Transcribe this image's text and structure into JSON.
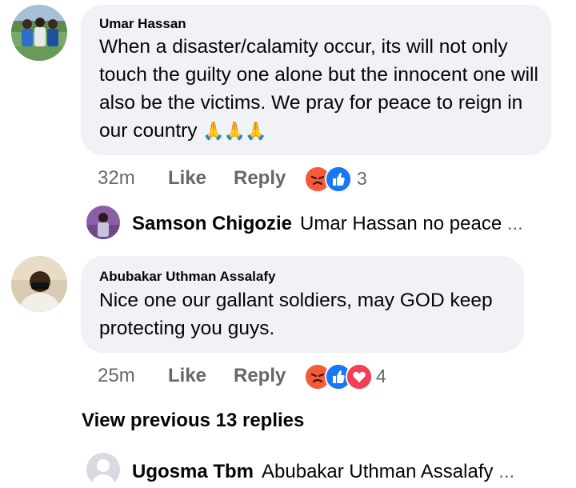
{
  "comments": [
    {
      "author": "Umar Hassan",
      "text": "When a disaster/calamity occur, its will not only touch the guilty one alone but the innocent one will also be the victims. We pray for peace to reign in our country",
      "emoji": "🙏🙏🙏",
      "time": "32m",
      "like_label": "Like",
      "reply_label": "Reply",
      "reactions": [
        "angry-reaction",
        "like-reaction"
      ],
      "reaction_count": "3",
      "reply_preview": {
        "author": "Samson Chigozie",
        "snippet": "Umar Hassan no peace",
        "ellipsis": "..."
      }
    },
    {
      "author": "Abubakar Uthman Assalafy",
      "text": "Nice one our gallant soldiers, may GOD keep protecting you guys.",
      "time": "25m",
      "like_label": "Like",
      "reply_label": "Reply",
      "reactions": [
        "angry-reaction",
        "like-reaction",
        "love-reaction"
      ],
      "reaction_count": "4",
      "view_previous": "View previous 13 replies",
      "reply_preview": {
        "author": "Ugosma Tbm",
        "snippet": "Abubakar Uthman Assalafy",
        "ellipsis": "..."
      }
    }
  ],
  "colors": {
    "bubble": "#f0f2f5",
    "meta": "#65676b",
    "like_blue": "#1877f2",
    "angry_orange": "#f7714c",
    "love_red": "#f33e58"
  }
}
